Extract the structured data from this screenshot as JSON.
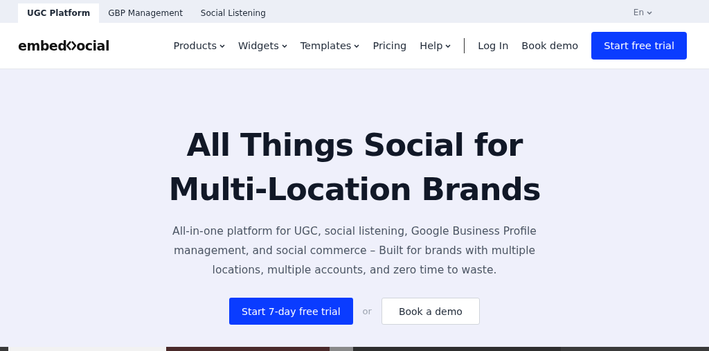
{
  "top_tabs": [
    {
      "label": "UGC Platform",
      "selected": true
    },
    {
      "label": "GBP Management",
      "selected": false
    },
    {
      "label": "Social Listening",
      "selected": false
    }
  ],
  "language": {
    "label": "En"
  },
  "logo": {
    "before": "embed",
    "after": "ocial"
  },
  "nav": [
    {
      "label": "Products",
      "dropdown": true
    },
    {
      "label": "Widgets",
      "dropdown": true
    },
    {
      "label": "Templates",
      "dropdown": true
    },
    {
      "label": "Pricing",
      "dropdown": false
    },
    {
      "label": "Help",
      "dropdown": true
    }
  ],
  "login": "Log In",
  "book_demo": "Book demo",
  "cta": "Start free trial",
  "hero": {
    "title_lines": [
      "All Things Social for",
      "Multi-Location Brands"
    ],
    "subtitle": "All-in-one platform for UGC, social listening, Google Business Profile management, and social commerce – Built for brands with multiple locations, multiple accounts, and zero time to waste.",
    "primary": "Start 7-day free trial",
    "or": "or",
    "secondary": "Book a demo"
  }
}
